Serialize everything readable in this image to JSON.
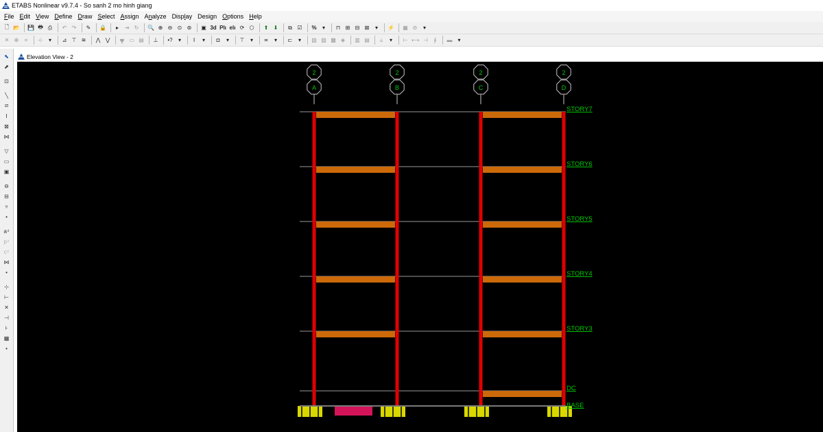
{
  "app": {
    "title": "ETABS Nonlinear v9.7.4 - So sanh 2 mo hinh giang"
  },
  "menu": [
    {
      "label": "File",
      "key": "F",
      "rest": "ile"
    },
    {
      "label": "Edit",
      "key": "E",
      "rest": "dit"
    },
    {
      "label": "View",
      "key": "V",
      "rest": "iew"
    },
    {
      "label": "Define",
      "key": "D",
      "rest": "efine"
    },
    {
      "label": "Draw",
      "key": "D",
      "rest": "raw"
    },
    {
      "label": "Select",
      "key": "S",
      "rest": "elect"
    },
    {
      "label": "Assign",
      "key": "A",
      "rest": "ssign"
    },
    {
      "label": "Analyze",
      "pre": "A",
      "key": "n",
      "rest": "alyze"
    },
    {
      "label": "Display",
      "pre": "Disp",
      "key": "l",
      "rest": "ay"
    },
    {
      "label": "Design",
      "pre": "Desi",
      "key": "g",
      "rest": "n"
    },
    {
      "label": "Options",
      "key": "O",
      "rest": "ptions"
    },
    {
      "label": "Help",
      "key": "H",
      "rest": "elp"
    }
  ],
  "toolbar": {
    "view_3d_label": "3d",
    "plan_label": "Plı",
    "elev_label": "elı",
    "percent_label": "%"
  },
  "elevation_window": {
    "title": "Elevation View - 2"
  },
  "grid_bubbles": [
    {
      "number": "2",
      "letter": "A"
    },
    {
      "number": "2",
      "letter": "B"
    },
    {
      "number": "2",
      "letter": "C"
    },
    {
      "number": "2",
      "letter": "D"
    }
  ],
  "stories": [
    {
      "name": "STORY7"
    },
    {
      "name": "STORY6"
    },
    {
      "name": "STORY5"
    },
    {
      "name": "STORY4"
    },
    {
      "name": "STORY3"
    },
    {
      "name": "DC"
    },
    {
      "name": "BASE"
    }
  ],
  "colors": {
    "canvas": "#000000",
    "column": "#e00000",
    "beam": "#cc6a0a",
    "grade_beam": "#d4145a",
    "support": "#d8d800",
    "story_text": "#00cc00",
    "grid_line": "#9a9a9a",
    "bubble_stroke": "#c8c8c8"
  }
}
